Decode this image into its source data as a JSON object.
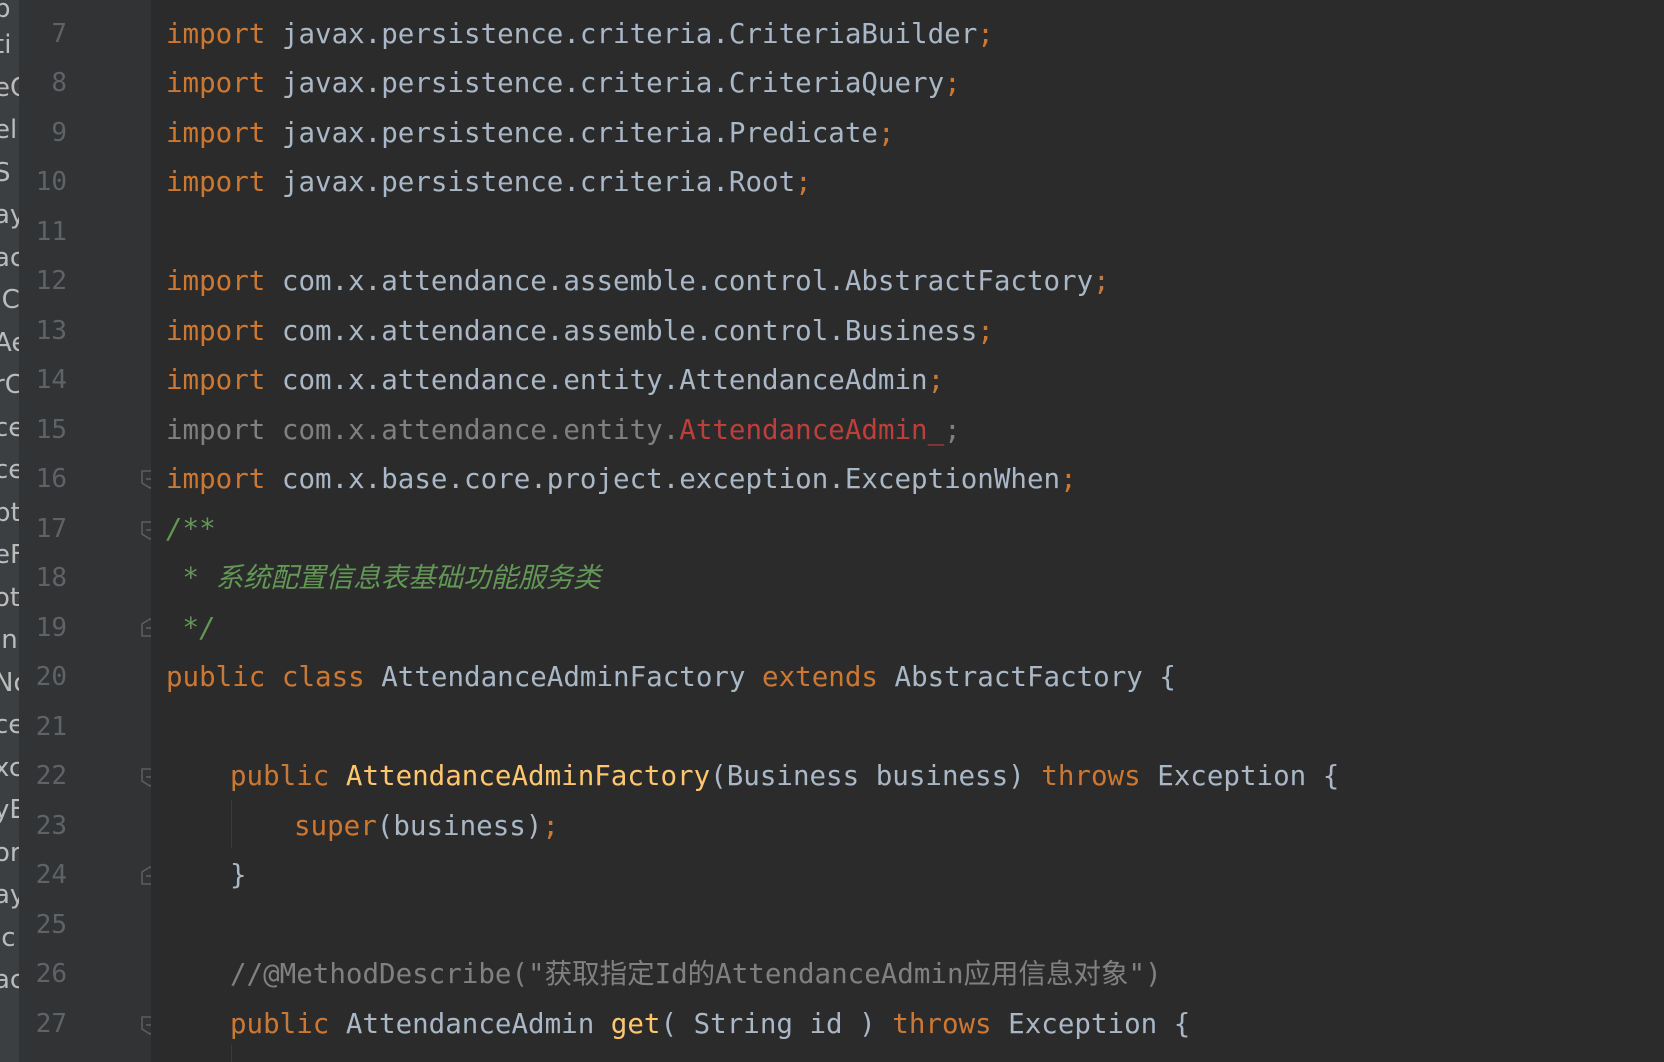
{
  "side_fragments": [
    "b",
    "ti",
    "eC",
    "el",
    "S",
    "ay",
    "ac",
    "IC",
    "Ae",
    "rC",
    "ce",
    "ce",
    "pt",
    "eF",
    "oty",
    "in",
    "No",
    "ce",
    "xc",
    "yE",
    "or",
    "ay",
    "lc",
    "ac"
  ],
  "line_numbers": [
    "7",
    "8",
    "9",
    "10",
    "11",
    "12",
    "13",
    "14",
    "15",
    "16",
    "17",
    "18",
    "19",
    "20",
    "21",
    "22",
    "23",
    "24",
    "25",
    "26",
    "27"
  ],
  "code": {
    "l7": {
      "kw": "import",
      "path": " javax.persistence.criteria.CriteriaBuilder",
      "semi": ";"
    },
    "l8": {
      "kw": "import",
      "path": " javax.persistence.criteria.CriteriaQuery",
      "semi": ";"
    },
    "l9": {
      "kw": "import",
      "path": " javax.persistence.criteria.Predicate",
      "semi": ";"
    },
    "l10": {
      "kw": "import",
      "path": " javax.persistence.criteria.Root",
      "semi": ";"
    },
    "l12": {
      "kw": "import",
      "path": " com.x.attendance.assemble.control.AbstractFactory",
      "semi": ";"
    },
    "l13": {
      "kw": "import",
      "path": " com.x.attendance.assemble.control.Business",
      "semi": ";"
    },
    "l14": {
      "kw": "import",
      "path": " com.x.attendance.entity.AttendanceAdmin",
      "semi": ";"
    },
    "l15": {
      "kw": "import",
      "path": " com.x.attendance.entity.",
      "err": "AttendanceAdmin_",
      "semi": ";"
    },
    "l16": {
      "kw": "import",
      "path": " com.x.base.core.project.exception.ExceptionWhen",
      "semi": ";"
    },
    "l17": {
      "doc": "/**"
    },
    "l18": {
      "doc_star": " * ",
      "doc_text": "系统配置信息表基础功能服务类"
    },
    "l19": {
      "doc": " */"
    },
    "l20": {
      "kw_public": "public",
      "kw_class": " class",
      "name": " AttendanceAdminFactory",
      "kw_extends": " extends",
      "rest": " AbstractFactory {"
    },
    "l22": {
      "kw_public": "public",
      "method": " AttendanceAdminFactory",
      "params": "(Business business)",
      "kw_throws": " throws",
      "rest": " Exception {"
    },
    "l23": {
      "kw_super": "super",
      "args": "(business)",
      "semi": ";"
    },
    "l24": {
      "brace": "}"
    },
    "l26": {
      "comment": "//@MethodDescribe(\"获取指定Id的AttendanceAdmin应用信息对象\")"
    },
    "l27": {
      "kw_public": "public",
      "type": " AttendanceAdmin",
      "method": " get",
      "params": "( String id )",
      "kw_throws": " throws",
      "rest": " Exception {"
    }
  },
  "colors": {
    "background": "#2b2b2b",
    "gutter": "#313335",
    "keyword": "#cc7832",
    "identifier": "#a9b7c6",
    "doc_comment": "#629755",
    "line_comment": "#808080",
    "error": "#bc3f3c",
    "method_declaration": "#ffc66d",
    "line_number": "#606366"
  },
  "icons": [
    "fold-collapse-icon",
    "fold-expand-icon"
  ]
}
